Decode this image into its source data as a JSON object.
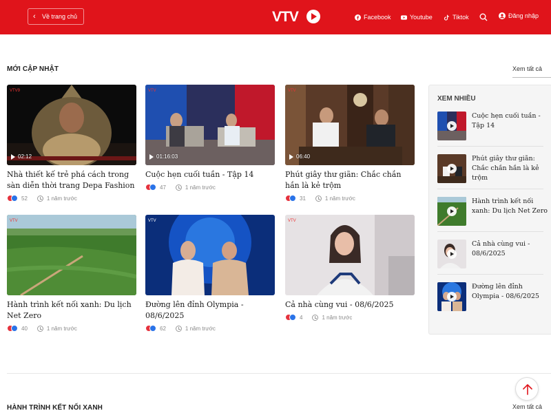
{
  "header": {
    "back_label": "Về trang chủ",
    "logo_text": "VTV",
    "links": [
      {
        "label": "Facebook",
        "icon": "facebook-icon"
      },
      {
        "label": "Youtube",
        "icon": "youtube-icon"
      },
      {
        "label": "Tiktok",
        "icon": "tiktok-icon"
      }
    ],
    "login_label": "Đăng nhập",
    "brand_color": "#e0141b"
  },
  "section1": {
    "title": "MỚI CẬP NHẬT",
    "see_all": "Xem tất cả"
  },
  "cards": [
    {
      "title": "Nhà thiết kế trẻ phá cách trong sàn diễn thời trang Depa Fashion",
      "duration": "02:12",
      "reactions": "52",
      "time": "1 năm trước"
    },
    {
      "title": "Cuộc hẹn cuối tuần - Tập 14",
      "duration": "01:16:03",
      "reactions": "47",
      "time": "1 năm trước"
    },
    {
      "title": "Phút giây thư giãn: Chắc chắn hắn là kẻ trộm",
      "duration": "06:40",
      "reactions": "31",
      "time": "1 năm trước"
    },
    {
      "title": "Hành trình kết nối xanh: Du lịch Net Zero",
      "duration": "",
      "reactions": "40",
      "time": "1 năm trước"
    },
    {
      "title": "Đường lên đỉnh Olympia - 08/6/2025",
      "duration": "",
      "reactions": "62",
      "time": "1 năm trước"
    },
    {
      "title": "Cả nhà cùng vui - 08/6/2025",
      "duration": "",
      "reactions": "4",
      "time": "1 năm trước"
    }
  ],
  "sidebar": {
    "title": "XEM NHIỀU",
    "items": [
      {
        "title": "Cuộc hẹn cuối tuần - Tập 14"
      },
      {
        "title": "Phút giây thư giãn: Chắc chắn hắn là kẻ trộm"
      },
      {
        "title": "Hành trình kết nối xanh: Du lịch Net Zero"
      },
      {
        "title": "Cả nhà cùng vui - 08/6/2025"
      },
      {
        "title": "Đường lên đỉnh Olympia - 08/6/2025"
      }
    ]
  },
  "section2": {
    "title": "HÀNH TRÌNH KẾT NỐI XANH",
    "see_all": "Xem tất cả"
  }
}
